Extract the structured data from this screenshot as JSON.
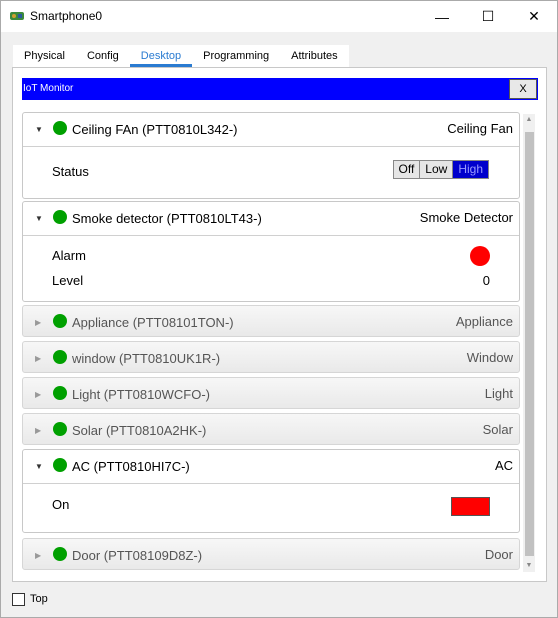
{
  "window": {
    "title": "Smartphone0",
    "minimize": "—",
    "maximize": "☐",
    "close": "✕"
  },
  "tabs": [
    {
      "label": "Physical",
      "active": false
    },
    {
      "label": "Config",
      "active": false
    },
    {
      "label": "Desktop",
      "active": true
    },
    {
      "label": "Programming",
      "active": false
    },
    {
      "label": "Attributes",
      "active": false
    }
  ],
  "monitor": {
    "title": "IoT Monitor",
    "close_label": "X"
  },
  "devices": [
    {
      "name": "Ceiling FAn (PTT0810L342-)",
      "type": "Ceiling Fan",
      "expanded": true,
      "status_color": "#00a000",
      "status_label": "Status",
      "options": [
        "Off",
        "Low",
        "High"
      ],
      "selected": "High"
    },
    {
      "name": "Smoke detector (PTT0810LT43-)",
      "type": "Smoke Detector",
      "expanded": true,
      "status_color": "#00a000",
      "alarm_label": "Alarm",
      "alarm_color": "#ff0000",
      "level_label": "Level",
      "level_value": "0"
    },
    {
      "name": "Appliance (PTT08101TON-)",
      "type": "Appliance",
      "expanded": false,
      "status_color": "#00a000"
    },
    {
      "name": "window (PTT0810UK1R-)",
      "type": "Window",
      "expanded": false,
      "status_color": "#00a000"
    },
    {
      "name": "Light (PTT0810WCFO-)",
      "type": "Light",
      "expanded": false,
      "status_color": "#00a000"
    },
    {
      "name": "Solar (PTT0810A2HK-)",
      "type": "Solar",
      "expanded": false,
      "status_color": "#00a000"
    },
    {
      "name": "AC (PTT0810HI7C-)",
      "type": "AC",
      "expanded": true,
      "status_color": "#00a000",
      "on_label": "On",
      "on_color": "#ff0000"
    },
    {
      "name": "Door (PTT08109D8Z-)",
      "type": "Door",
      "expanded": false,
      "status_color": "#00a000"
    }
  ],
  "footer": {
    "top_label": "Top",
    "top_checked": false
  },
  "icons": {
    "expanded_chevron": "▼",
    "collapsed_chevron": "▶",
    "scroll_up": "▲",
    "scroll_down": "▼"
  }
}
